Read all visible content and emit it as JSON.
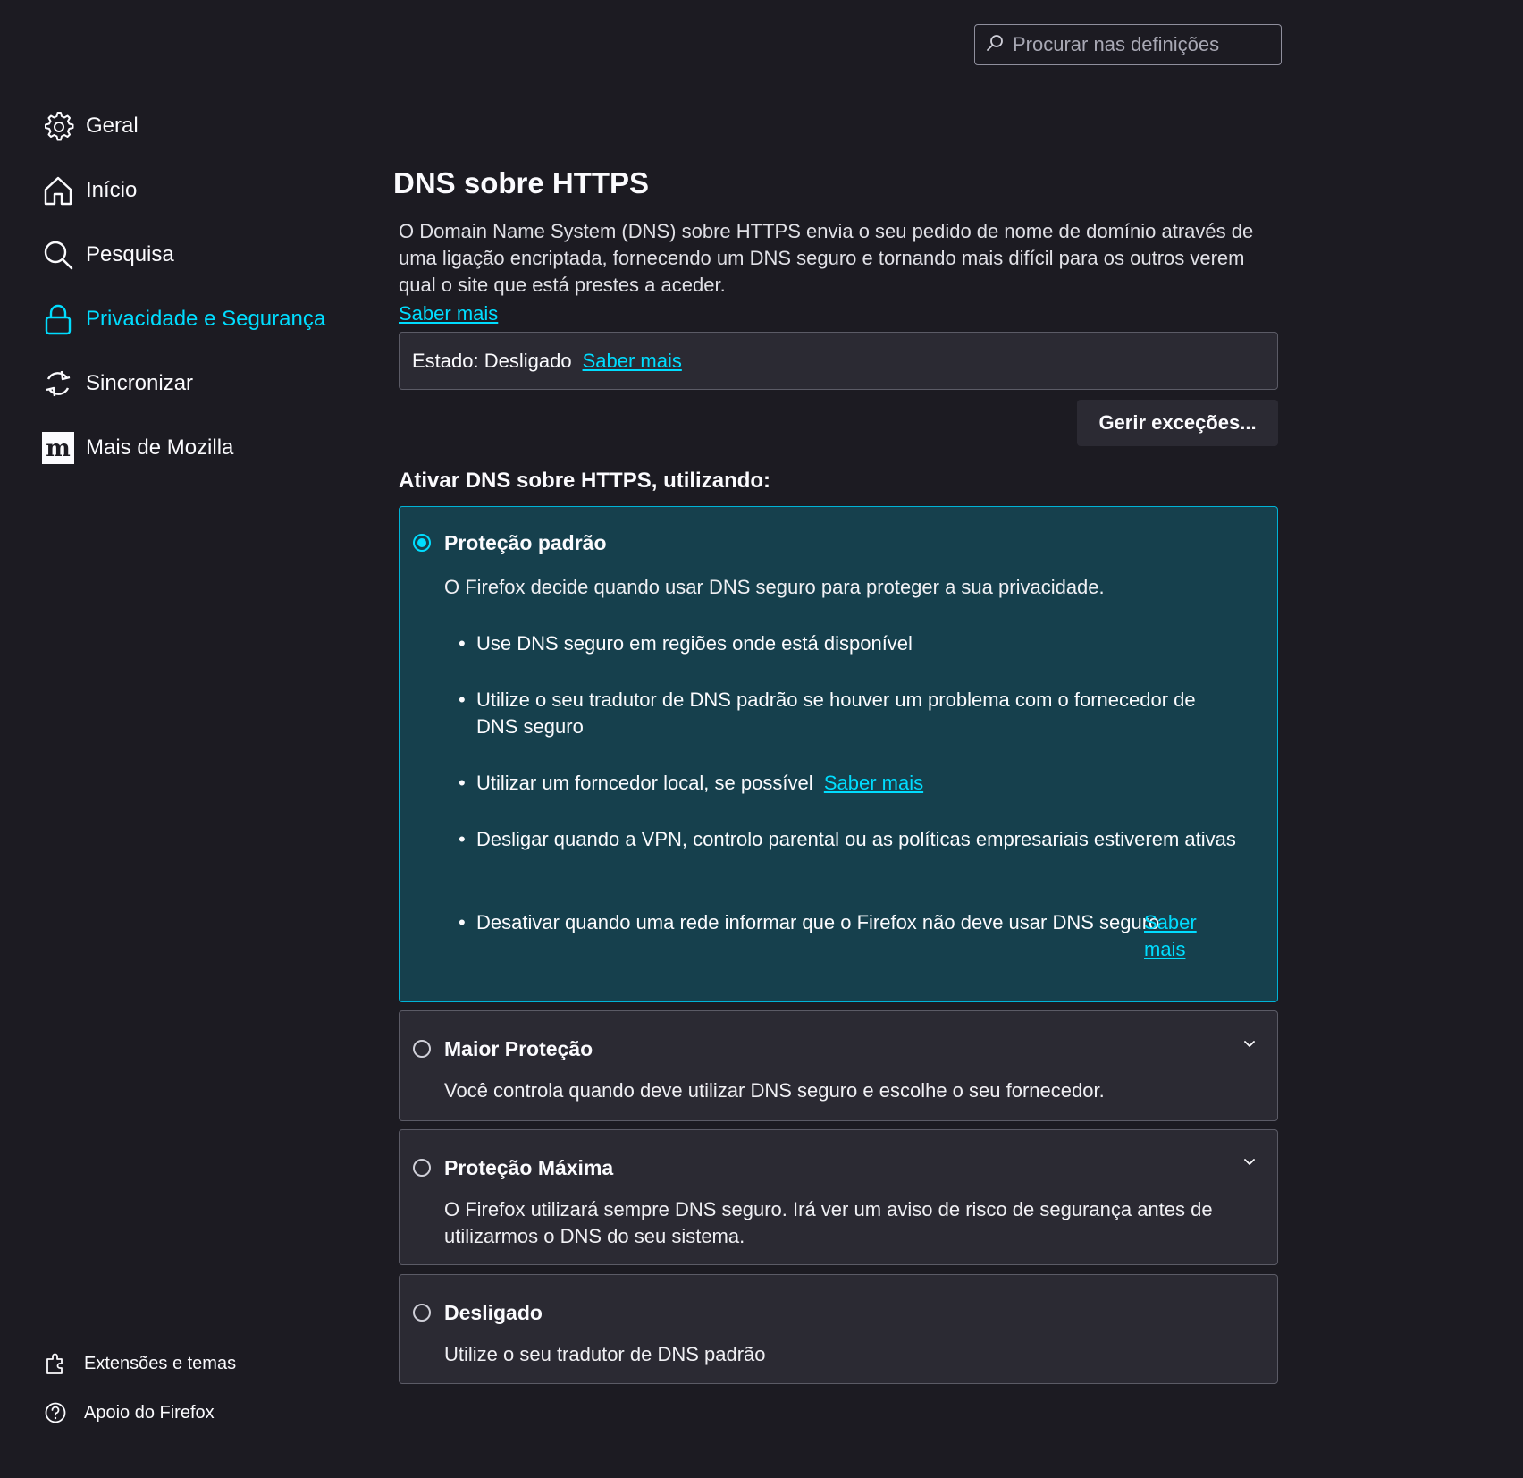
{
  "search": {
    "placeholder": "Procurar nas definições"
  },
  "sidebar": {
    "items": [
      {
        "label": "Geral",
        "icon": "gear-icon"
      },
      {
        "label": "Início",
        "icon": "home-icon"
      },
      {
        "label": "Pesquisa",
        "icon": "search-icon"
      },
      {
        "label": "Privacidade e Segurança",
        "icon": "lock-icon",
        "active": true
      },
      {
        "label": "Sincronizar",
        "icon": "sync-icon"
      },
      {
        "label": "Mais de Mozilla",
        "icon": "mozilla-icon"
      }
    ],
    "footer": [
      {
        "label": "Extensões e temas",
        "icon": "puzzle-icon"
      },
      {
        "label": "Apoio do Firefox",
        "icon": "help-icon"
      }
    ]
  },
  "section": {
    "title": "DNS sobre HTTPS",
    "description": "O Domain Name System (DNS) sobre HTTPS envia o seu pedido de nome de domínio através de uma ligação encriptada, fornecendo um DNS seguro e tornando mais difícil para os outros verem qual o site que está prestes a aceder.",
    "learn_more": "Saber mais",
    "status_text": "Estado: Desligado",
    "status_learn_more": "Saber mais",
    "manage_exceptions": "Gerir exceções...",
    "enable_heading": "Ativar DNS sobre HTTPS, utilizando:"
  },
  "options": {
    "default": {
      "title": "Proteção padrão",
      "description": "O Firefox decide quando usar DNS seguro para proteger a sua privacidade.",
      "bullets": [
        "Use DNS seguro em regiões onde está disponível",
        "Utilize o seu tradutor de DNS padrão se houver um problema com o fornecedor de DNS seguro",
        "Utilizar um forncedor local, se possível",
        "Desligar quando a VPN, controlo parental ou as políticas empresariais estiverem ativas",
        "Desativar quando uma rede informar que o Firefox não deve usar DNS seguro"
      ],
      "bullet3_link": "Saber mais",
      "bullet5_link": "Saber mais"
    },
    "increased": {
      "title": "Maior Proteção",
      "description": "Você controla quando deve utilizar DNS seguro e escolhe o seu fornecedor."
    },
    "max": {
      "title": "Proteção Máxima",
      "description": "O Firefox utilizará sempre DNS seguro. Irá ver um aviso de risco de segurança antes de utilizarmos o DNS do seu sistema."
    },
    "off": {
      "title": "Desligado",
      "description": "Utilize o seu tradutor de DNS padrão"
    },
    "selected": "default"
  },
  "colors": {
    "background": "#1c1b22",
    "panel": "#2b2a33",
    "accent": "#00ddff",
    "selected_panel": "#16404d"
  }
}
